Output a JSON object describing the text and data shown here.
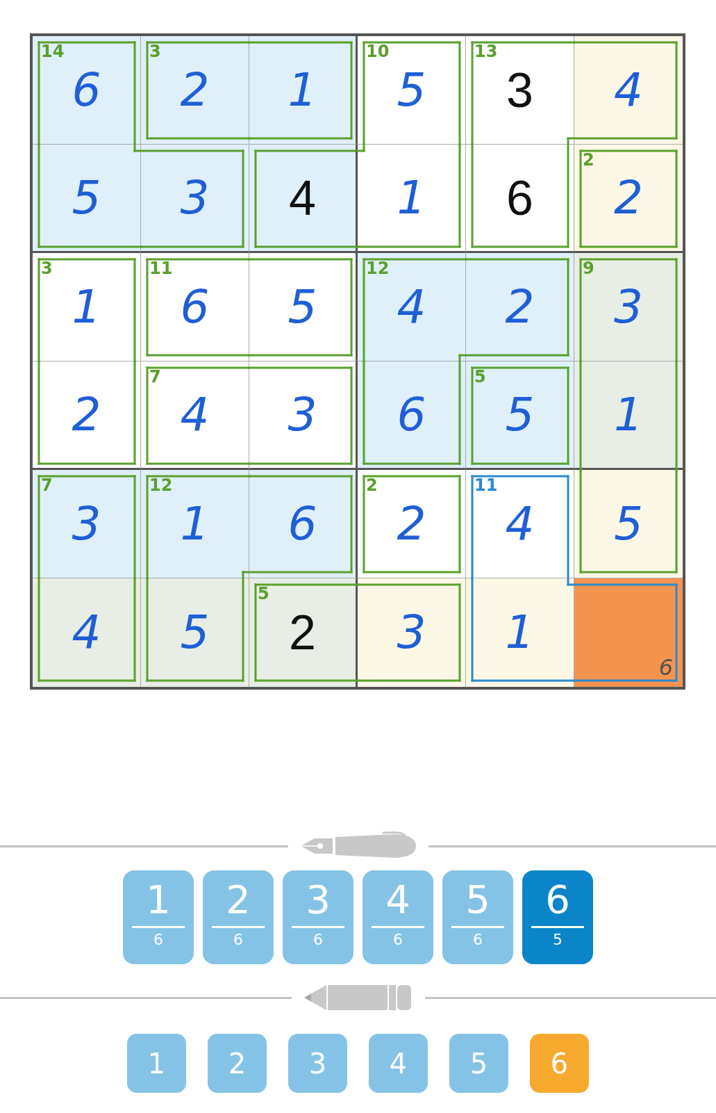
{
  "board": {
    "rows": [
      {
        "cells": [
          {
            "value": "6",
            "given": false,
            "color": "#dff0fb",
            "cage_sum": "14",
            "border_top": true,
            "border_right": true,
            "border_left": true,
            "selected": false
          },
          {
            "value": "2",
            "given": false,
            "color": "#dff0fb",
            "cage_sum": "3",
            "border_top": true,
            "border_bottom": true,
            "border_left": true,
            "selected": false
          },
          {
            "value": "1",
            "given": false,
            "color": "#dff0fb",
            "border_top": true,
            "border_right": true,
            "border_bottom": true,
            "selected": false
          },
          {
            "value": "5",
            "given": false,
            "color": "#ffffff",
            "cage_sum": "10",
            "border_top": true,
            "border_right": true,
            "border_left": true,
            "selected": false
          },
          {
            "value": "3",
            "given": true,
            "color": "#ffffff",
            "cage_sum": "13",
            "border_top": true,
            "border_left": true,
            "selected": false
          },
          {
            "value": "4",
            "given": false,
            "color": "#fdf8e6",
            "border_top": true,
            "border_right": true,
            "border_bottom": true,
            "selected": false
          }
        ]
      },
      {
        "cells": [
          {
            "value": "5",
            "given": false,
            "color": "#dff0fb",
            "border_bottom": true,
            "border_left": true,
            "selected": false
          },
          {
            "value": "3",
            "given": false,
            "color": "#dff0fb",
            "border_top": true,
            "border_right": true,
            "border_bottom": true,
            "selected": false
          },
          {
            "value": "4",
            "given": true,
            "color": "#dff0fb",
            "border_top": true,
            "border_bottom": true,
            "border_left": true,
            "selected": false
          },
          {
            "value": "1",
            "given": false,
            "color": "#ffffff",
            "border_right": true,
            "border_bottom": true,
            "selected": false
          },
          {
            "value": "6",
            "given": true,
            "color": "#ffffff",
            "border_right": true,
            "border_bottom": true,
            "border_left": true,
            "selected": false
          },
          {
            "value": "2",
            "given": false,
            "color": "#fdf8e6",
            "cage_sum": "2",
            "border_top": true,
            "border_right": true,
            "border_bottom": true,
            "border_left": true,
            "selected": false
          }
        ]
      },
      {
        "cells": [
          {
            "value": "1",
            "given": false,
            "color": "#ffffff",
            "cage_sum": "3",
            "border_top": true,
            "border_right": true,
            "border_left": true,
            "selected": false
          },
          {
            "value": "6",
            "given": false,
            "color": "#ffffff",
            "cage_sum": "11",
            "border_top": true,
            "border_bottom": true,
            "border_left": true,
            "selected": false
          },
          {
            "value": "5",
            "given": false,
            "color": "#ffffff",
            "border_top": true,
            "border_right": true,
            "border_bottom": true,
            "selected": false
          },
          {
            "value": "4",
            "given": false,
            "color": "#dff0fb",
            "cage_sum": "12",
            "border_top": true,
            "border_left": true,
            "selected": false
          },
          {
            "value": "2",
            "given": false,
            "color": "#dff0fb",
            "border_top": true,
            "border_right": true,
            "border_bottom": true,
            "selected": false
          },
          {
            "value": "3",
            "given": false,
            "color": "#e8eee6",
            "cage_sum": "9",
            "border_top": true,
            "border_right": true,
            "border_left": true,
            "selected": false
          }
        ]
      },
      {
        "cells": [
          {
            "value": "2",
            "given": false,
            "color": "#ffffff",
            "border_right": true,
            "border_bottom": true,
            "border_left": true,
            "selected": false
          },
          {
            "value": "4",
            "given": false,
            "color": "#ffffff",
            "cage_sum": "7",
            "border_top": true,
            "border_bottom": true,
            "border_left": true,
            "selected": false
          },
          {
            "value": "3",
            "given": false,
            "color": "#ffffff",
            "border_top": true,
            "border_right": true,
            "border_bottom": true,
            "selected": false
          },
          {
            "value": "6",
            "given": false,
            "color": "#dff0fb",
            "border_right": true,
            "border_bottom": true,
            "border_left": true,
            "selected": false
          },
          {
            "value": "5",
            "given": false,
            "color": "#dff0fb",
            "cage_sum": "5",
            "border_top": true,
            "border_right": true,
            "border_bottom": true,
            "border_left": true,
            "selected": false
          },
          {
            "value": "1",
            "given": false,
            "color": "#e8eee6",
            "border_right": true,
            "border_left": true,
            "selected": false
          }
        ]
      },
      {
        "cells": [
          {
            "value": "3",
            "given": false,
            "color": "#dff0fb",
            "cage_sum": "7",
            "border_top": true,
            "border_right": true,
            "border_left": true,
            "selected": false
          },
          {
            "value": "1",
            "given": false,
            "color": "#dff0fb",
            "cage_sum": "12",
            "border_top": true,
            "border_left": true,
            "selected": false
          },
          {
            "value": "6",
            "given": false,
            "color": "#dff0fb",
            "border_top": true,
            "border_right": true,
            "border_bottom": true,
            "selected": false
          },
          {
            "value": "2",
            "given": false,
            "color": "#ffffff",
            "cage_sum": "2",
            "border_top": true,
            "border_right": true,
            "border_bottom": true,
            "border_left": true,
            "selected": false
          },
          {
            "value": "4",
            "given": false,
            "color": "#ffffff",
            "cage_sum": "11",
            "border_top": true,
            "border_right": true,
            "border_left": true,
            "selected": false
          },
          {
            "value": "5",
            "given": false,
            "color": "#fdf8e6",
            "border_right": true,
            "border_bottom": true,
            "border_left": true,
            "selected": false
          }
        ]
      },
      {
        "cells": [
          {
            "value": "4",
            "given": false,
            "color": "#e8eee6",
            "border_right": true,
            "border_bottom": true,
            "border_left": true,
            "selected": false
          },
          {
            "value": "5",
            "given": false,
            "color": "#e8eee6",
            "border_right": true,
            "border_bottom": true,
            "border_left": true,
            "selected": false
          },
          {
            "value": "2",
            "given": true,
            "color": "#e8eee6",
            "cage_sum": "5",
            "border_top": true,
            "border_bottom": true,
            "border_left": true,
            "selected": false
          },
          {
            "value": "3",
            "given": false,
            "color": "#fdf8e6",
            "border_top": true,
            "border_right": true,
            "border_bottom": true,
            "selected": false
          },
          {
            "value": "1",
            "given": false,
            "color": "#fdf8e6",
            "border_bottom": true,
            "border_left": true,
            "selected": false
          },
          {
            "pencil_marks": [
              "6"
            ],
            "border_top": true,
            "border_right": true,
            "border_bottom": true,
            "selected": true
          }
        ]
      }
    ]
  },
  "pen_digits": [
    {
      "digit": "1",
      "count": "6",
      "selected": false
    },
    {
      "digit": "2",
      "count": "6",
      "selected": false
    },
    {
      "digit": "3",
      "count": "6",
      "selected": false
    },
    {
      "digit": "4",
      "count": "6",
      "selected": false
    },
    {
      "digit": "5",
      "count": "6",
      "selected": false
    },
    {
      "digit": "6",
      "count": "5",
      "selected": true
    }
  ],
  "pencil_digits": [
    {
      "digit": "1",
      "selected": false
    },
    {
      "digit": "2",
      "selected": false
    },
    {
      "digit": "3",
      "selected": false
    },
    {
      "digit": "4",
      "selected": false
    },
    {
      "digit": "5",
      "selected": false
    },
    {
      "digit": "6",
      "selected": true
    }
  ]
}
